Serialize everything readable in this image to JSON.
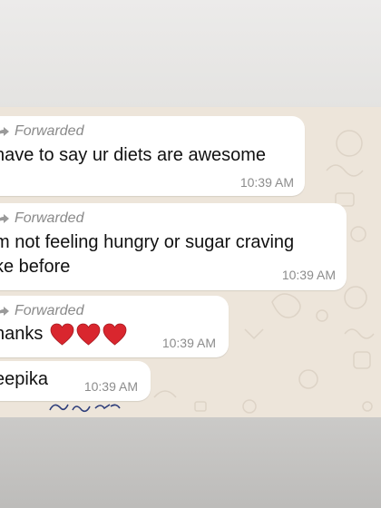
{
  "colors": {
    "bubble": "#ffffff",
    "chat_background": "#ede5da",
    "forwarded_text": "#8a8a8a",
    "heart": "#d9262e"
  },
  "messages": [
    {
      "forwarded_label": "Forwarded",
      "text_lines": [
        "have to say ur diets are awesome"
      ],
      "time": "10:39 AM"
    },
    {
      "forwarded_label": "Forwarded",
      "text_lines": [
        "m not feeling hungry or sugar craving",
        "ke before"
      ],
      "time": "10:39 AM"
    },
    {
      "forwarded_label": "Forwarded",
      "text_lines": [
        "hanks"
      ],
      "emoji": "red-heart x3",
      "time": "10:39 AM"
    },
    {
      "text_lines": [
        "eepika"
      ],
      "time": "10:39 AM"
    }
  ]
}
